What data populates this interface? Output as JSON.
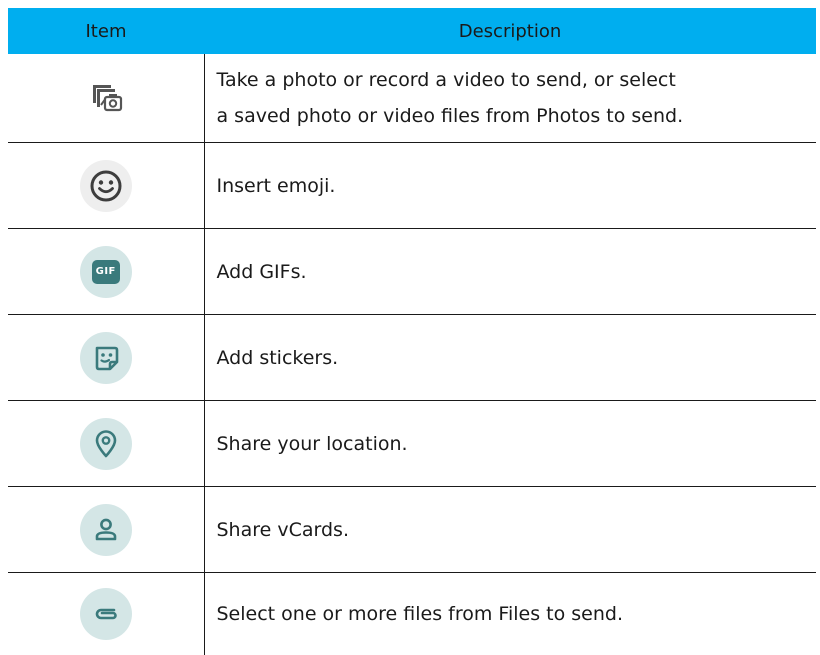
{
  "colors": {
    "header_bg": "#00aeef",
    "icon_circle_bg": "#d4e6e6",
    "icon_stroke": "#3a7a7c",
    "emoji_circle_bg": "#eeeeee",
    "emoji_stroke": "#3d3d3d",
    "gif_badge_bg": "#3a7a7c"
  },
  "table": {
    "headers": {
      "item": "Item",
      "description": "Description"
    },
    "rows": [
      {
        "icon": "photo-camera-icon",
        "description_line1": "Take a photo or record a video to send, or select",
        "description_line2": "a saved photo or video files from Photos to send."
      },
      {
        "icon": "emoji-icon",
        "description": "Insert emoji."
      },
      {
        "icon": "gif-icon",
        "icon_text": "GIF",
        "description": "Add GIFs."
      },
      {
        "icon": "sticker-icon",
        "description": "Add stickers."
      },
      {
        "icon": "location-pin-icon",
        "description": "Share your location."
      },
      {
        "icon": "contact-card-icon",
        "description": "Share vCards."
      },
      {
        "icon": "paperclip-icon",
        "description": "Select one or more files from Files to send."
      }
    ]
  }
}
